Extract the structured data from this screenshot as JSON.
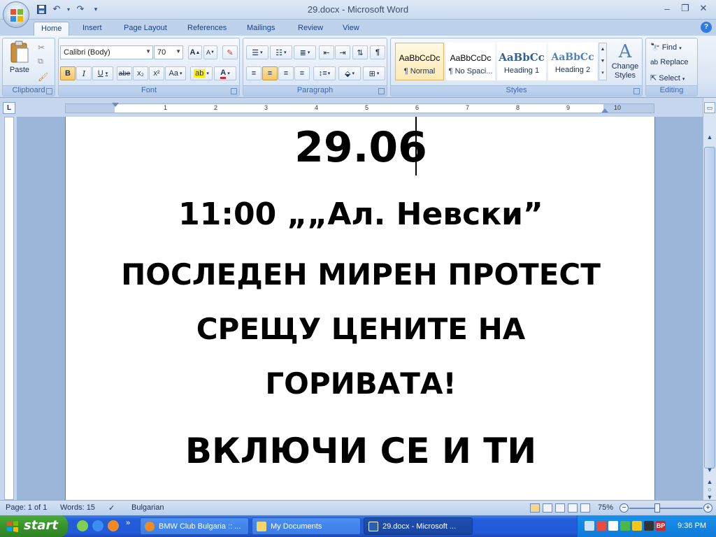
{
  "window": {
    "title": "29.docx - Microsoft Word"
  },
  "qat": {
    "save": "save-icon",
    "undo": "undo-icon",
    "redo": "redo-icon",
    "customize": "customize-icon"
  },
  "tabs": [
    "Home",
    "Insert",
    "Page Layout",
    "References",
    "Mailings",
    "Review",
    "View"
  ],
  "help": "?",
  "ribbon": {
    "clipboard": {
      "label": "Clipboard",
      "paste": "Paste"
    },
    "font": {
      "label": "Font",
      "name": "Calibri (Body)",
      "size": "70",
      "bold": "B",
      "italic": "I",
      "underline": "U",
      "strike": "abe",
      "subscript": "x₂",
      "superscript": "x²",
      "change_case": "Aa",
      "grow": "A",
      "shrink": "A"
    },
    "paragraph": {
      "label": "Paragraph",
      "pilcrow": "¶"
    },
    "styles": {
      "label": "Styles",
      "change_styles": "Change Styles",
      "items": [
        {
          "sample": "AaBbCcDc",
          "name": "¶ Normal"
        },
        {
          "sample": "AaBbCcDc",
          "name": "¶ No Spaci..."
        },
        {
          "sample": "AaBbCc",
          "name": "Heading 1"
        },
        {
          "sample": "AaBbCc",
          "name": "Heading 2"
        }
      ]
    },
    "editing": {
      "label": "Editing",
      "find": "Find",
      "replace": "Replace",
      "select": "Select"
    }
  },
  "ruler": {
    "numbers": [
      "1",
      "2",
      "3",
      "4",
      "5",
      "6",
      "7",
      "8",
      "9",
      "10"
    ]
  },
  "document": {
    "lines": [
      "29.06",
      "11:00  „„Ал. Невски”",
      "ПОСЛЕДЕН МИРЕН ПРОТЕСТ",
      "СРЕЩУ ЦЕНИТЕ НА",
      "ГОРИВАТА!",
      "ВКЛЮЧИ СЕ И ТИ"
    ]
  },
  "status": {
    "page": "Page: 1 of 1",
    "words": "Words: 15",
    "language": "Bulgarian",
    "zoom": "75%"
  },
  "taskbar": {
    "start": "start",
    "tasks": [
      "BMW Club Bulgaria :: ...",
      "My Documents",
      "29.docx - Microsoft ..."
    ],
    "clock": "9:36 PM",
    "tray_text": "BP"
  }
}
